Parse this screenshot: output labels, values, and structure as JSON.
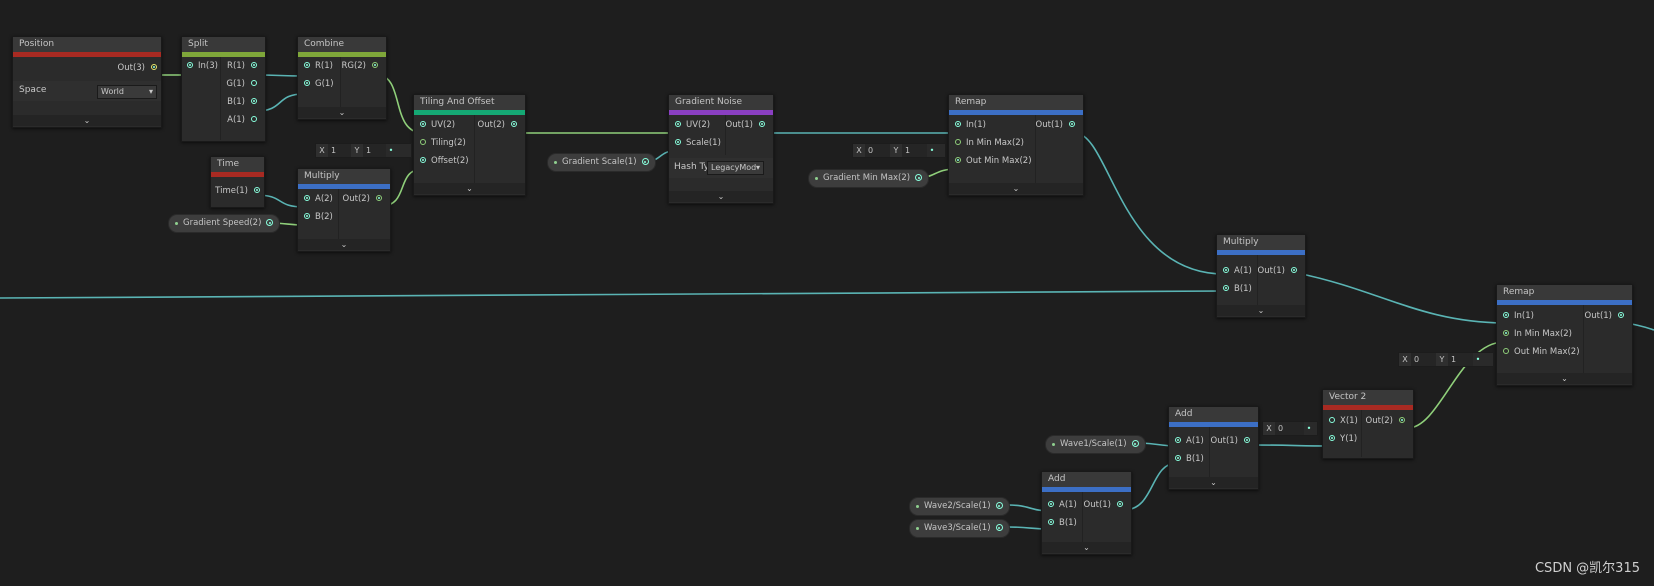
{
  "colors": {
    "red": "#a82a22",
    "green": "#7fa73a",
    "teal": "#15a874",
    "purple": "#8a3fc2",
    "blue": "#3c6fc5",
    "wire_teal": "#5ab4b4",
    "wire_green": "#8fcf7a"
  },
  "nodes": {
    "position": {
      "title": "Position",
      "out": "Out(3)",
      "space_label": "Space",
      "space_value": "World"
    },
    "split": {
      "title": "Split",
      "in": "In(3)",
      "outs": [
        "R(1)",
        "G(1)",
        "B(1)",
        "A(1)"
      ]
    },
    "combine": {
      "title": "Combine",
      "ins": [
        "R(1)",
        "G(1)"
      ],
      "out": "RG(2)"
    },
    "time": {
      "title": "Time",
      "out": "Time(1)"
    },
    "multiply1": {
      "title": "Multiply",
      "ins": [
        "A(2)",
        "B(2)"
      ],
      "out": "Out(2)"
    },
    "tiling": {
      "title": "Tiling And Offset",
      "ins": [
        "UV(2)",
        "Tiling(2)",
        "Offset(2)"
      ],
      "out": "Out(2)"
    },
    "noise": {
      "title": "Gradient Noise",
      "ins": [
        "UV(2)",
        "Scale(1)"
      ],
      "out": "Out(1)",
      "hash_label": "Hash Ty",
      "hash_value": "LegacyMod"
    },
    "remap1": {
      "title": "Remap",
      "ins": [
        "In(1)",
        "In Min Max(2)",
        "Out Min Max(2)"
      ],
      "out": "Out(1)"
    },
    "multiply2": {
      "title": "Multiply",
      "ins": [
        "A(1)",
        "B(1)"
      ],
      "out": "Out(1)"
    },
    "remap2": {
      "title": "Remap",
      "ins": [
        "In(1)",
        "In Min Max(2)",
        "Out Min Max(2)"
      ],
      "out": "Out(1)"
    },
    "vector2": {
      "title": "Vector 2",
      "ins": [
        "X(1)",
        "Y(1)"
      ],
      "out": "Out(2)"
    },
    "add1": {
      "title": "Add",
      "ins": [
        "A(1)",
        "B(1)"
      ],
      "out": "Out(1)"
    },
    "add2": {
      "title": "Add",
      "ins": [
        "A(1)",
        "B(1)"
      ],
      "out": "Out(1)"
    }
  },
  "properties": {
    "gradient_speed": "Gradient Speed(2)",
    "gradient_scale": "Gradient Scale(1)",
    "gradient_min_max": "Gradient Min Max(2)",
    "wave1_scale": "Wave1/Scale(1)",
    "wave2_scale": "Wave2/Scale(1)",
    "wave3_scale": "Wave3/Scale(1)"
  },
  "fields": {
    "tiling": {
      "x_label": "X",
      "x": "1",
      "y_label": "Y",
      "y": "1"
    },
    "remap1_inminmax": {
      "x_label": "X",
      "x": "0",
      "y_label": "Y",
      "y": "1"
    },
    "remap2_outminmax": {
      "x_label": "X",
      "x": "0",
      "y_label": "Y",
      "y": "1"
    },
    "vector2_x": {
      "x_label": "X",
      "x": "0"
    }
  },
  "watermark": "CSDN @凯尔315",
  "footer_chevron": "⌄"
}
